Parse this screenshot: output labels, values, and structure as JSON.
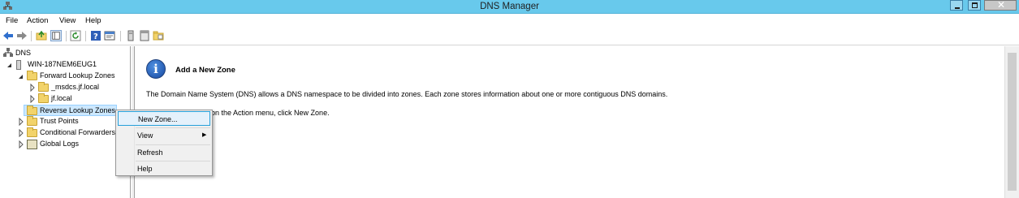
{
  "window": {
    "title": "DNS Manager"
  },
  "menu": [
    "File",
    "Action",
    "View",
    "Help"
  ],
  "toolbar": {
    "buttons": [
      "back-icon",
      "forward-icon",
      "up-folder-icon",
      "show-hide-tree-icon",
      "refresh-icon",
      "help-icon",
      "properties-icon",
      "server-icon",
      "panel-icon",
      "folder-icon"
    ]
  },
  "tree": {
    "root": "DNS",
    "server": "WIN-187NEM6EUG1",
    "forward": "Forward Lookup Zones",
    "msdcs": "_msdcs.jf.local",
    "jf": "jf.local",
    "reverse": "Reverse Lookup Zones",
    "trust": "Trust Points",
    "conditional": "Conditional Forwarders",
    "logs": "Global Logs"
  },
  "content": {
    "title": "Add a New Zone",
    "description": "The Domain Name System (DNS) allows a DNS namespace to be divided into zones. Each zone stores information about one or more contiguous DNS domains.",
    "instruction": "To add a new zone, on the Action menu, click New Zone.",
    "instruction_visible": "on the Action menu, click New Zone."
  },
  "context_menu": {
    "items": [
      "New Zone...",
      "View",
      "Refresh",
      "Help"
    ]
  },
  "colors": {
    "titlebar": "#68c9ec",
    "selection": "#cce8ff",
    "menu_highlight": "#e5f1fb"
  }
}
